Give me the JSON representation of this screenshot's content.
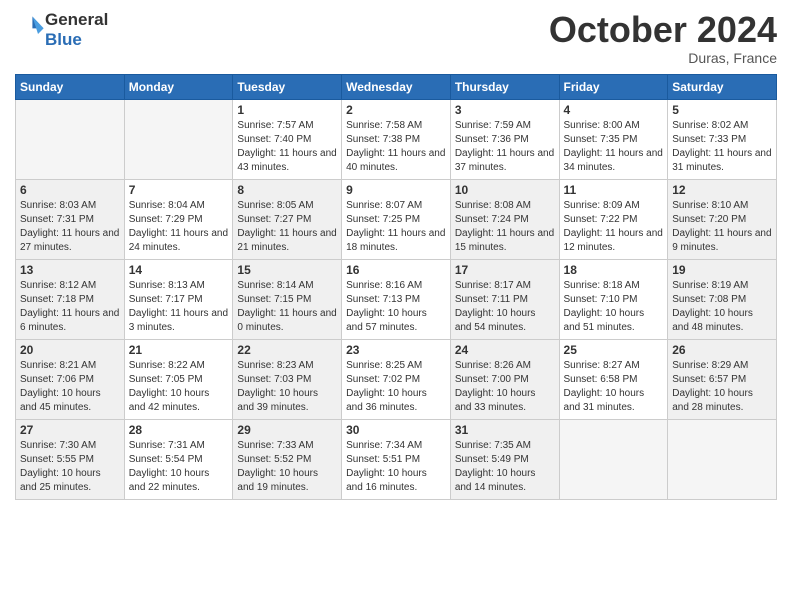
{
  "header": {
    "logo_line1": "General",
    "logo_line2": "Blue",
    "month_title": "October 2024",
    "location": "Duras, France"
  },
  "days_of_week": [
    "Sunday",
    "Monday",
    "Tuesday",
    "Wednesday",
    "Thursday",
    "Friday",
    "Saturday"
  ],
  "weeks": [
    [
      {
        "num": "",
        "info": "",
        "empty": true
      },
      {
        "num": "",
        "info": "",
        "empty": true
      },
      {
        "num": "1",
        "info": "Sunrise: 7:57 AM\nSunset: 7:40 PM\nDaylight: 11 hours and 43 minutes."
      },
      {
        "num": "2",
        "info": "Sunrise: 7:58 AM\nSunset: 7:38 PM\nDaylight: 11 hours and 40 minutes."
      },
      {
        "num": "3",
        "info": "Sunrise: 7:59 AM\nSunset: 7:36 PM\nDaylight: 11 hours and 37 minutes."
      },
      {
        "num": "4",
        "info": "Sunrise: 8:00 AM\nSunset: 7:35 PM\nDaylight: 11 hours and 34 minutes."
      },
      {
        "num": "5",
        "info": "Sunrise: 8:02 AM\nSunset: 7:33 PM\nDaylight: 11 hours and 31 minutes."
      }
    ],
    [
      {
        "num": "6",
        "info": "Sunrise: 8:03 AM\nSunset: 7:31 PM\nDaylight: 11 hours and 27 minutes.",
        "shaded": true
      },
      {
        "num": "7",
        "info": "Sunrise: 8:04 AM\nSunset: 7:29 PM\nDaylight: 11 hours and 24 minutes."
      },
      {
        "num": "8",
        "info": "Sunrise: 8:05 AM\nSunset: 7:27 PM\nDaylight: 11 hours and 21 minutes.",
        "shaded": true
      },
      {
        "num": "9",
        "info": "Sunrise: 8:07 AM\nSunset: 7:25 PM\nDaylight: 11 hours and 18 minutes."
      },
      {
        "num": "10",
        "info": "Sunrise: 8:08 AM\nSunset: 7:24 PM\nDaylight: 11 hours and 15 minutes.",
        "shaded": true
      },
      {
        "num": "11",
        "info": "Sunrise: 8:09 AM\nSunset: 7:22 PM\nDaylight: 11 hours and 12 minutes."
      },
      {
        "num": "12",
        "info": "Sunrise: 8:10 AM\nSunset: 7:20 PM\nDaylight: 11 hours and 9 minutes.",
        "shaded": true
      }
    ],
    [
      {
        "num": "13",
        "info": "Sunrise: 8:12 AM\nSunset: 7:18 PM\nDaylight: 11 hours and 6 minutes.",
        "shaded": true
      },
      {
        "num": "14",
        "info": "Sunrise: 8:13 AM\nSunset: 7:17 PM\nDaylight: 11 hours and 3 minutes."
      },
      {
        "num": "15",
        "info": "Sunrise: 8:14 AM\nSunset: 7:15 PM\nDaylight: 11 hours and 0 minutes.",
        "shaded": true
      },
      {
        "num": "16",
        "info": "Sunrise: 8:16 AM\nSunset: 7:13 PM\nDaylight: 10 hours and 57 minutes."
      },
      {
        "num": "17",
        "info": "Sunrise: 8:17 AM\nSunset: 7:11 PM\nDaylight: 10 hours and 54 minutes.",
        "shaded": true
      },
      {
        "num": "18",
        "info": "Sunrise: 8:18 AM\nSunset: 7:10 PM\nDaylight: 10 hours and 51 minutes."
      },
      {
        "num": "19",
        "info": "Sunrise: 8:19 AM\nSunset: 7:08 PM\nDaylight: 10 hours and 48 minutes.",
        "shaded": true
      }
    ],
    [
      {
        "num": "20",
        "info": "Sunrise: 8:21 AM\nSunset: 7:06 PM\nDaylight: 10 hours and 45 minutes.",
        "shaded": true
      },
      {
        "num": "21",
        "info": "Sunrise: 8:22 AM\nSunset: 7:05 PM\nDaylight: 10 hours and 42 minutes."
      },
      {
        "num": "22",
        "info": "Sunrise: 8:23 AM\nSunset: 7:03 PM\nDaylight: 10 hours and 39 minutes.",
        "shaded": true
      },
      {
        "num": "23",
        "info": "Sunrise: 8:25 AM\nSunset: 7:02 PM\nDaylight: 10 hours and 36 minutes."
      },
      {
        "num": "24",
        "info": "Sunrise: 8:26 AM\nSunset: 7:00 PM\nDaylight: 10 hours and 33 minutes.",
        "shaded": true
      },
      {
        "num": "25",
        "info": "Sunrise: 8:27 AM\nSunset: 6:58 PM\nDaylight: 10 hours and 31 minutes."
      },
      {
        "num": "26",
        "info": "Sunrise: 8:29 AM\nSunset: 6:57 PM\nDaylight: 10 hours and 28 minutes.",
        "shaded": true
      }
    ],
    [
      {
        "num": "27",
        "info": "Sunrise: 7:30 AM\nSunset: 5:55 PM\nDaylight: 10 hours and 25 minutes.",
        "shaded": true
      },
      {
        "num": "28",
        "info": "Sunrise: 7:31 AM\nSunset: 5:54 PM\nDaylight: 10 hours and 22 minutes."
      },
      {
        "num": "29",
        "info": "Sunrise: 7:33 AM\nSunset: 5:52 PM\nDaylight: 10 hours and 19 minutes.",
        "shaded": true
      },
      {
        "num": "30",
        "info": "Sunrise: 7:34 AM\nSunset: 5:51 PM\nDaylight: 10 hours and 16 minutes."
      },
      {
        "num": "31",
        "info": "Sunrise: 7:35 AM\nSunset: 5:49 PM\nDaylight: 10 hours and 14 minutes.",
        "shaded": true
      },
      {
        "num": "",
        "info": "",
        "empty": true
      },
      {
        "num": "",
        "info": "",
        "empty": true
      }
    ]
  ]
}
